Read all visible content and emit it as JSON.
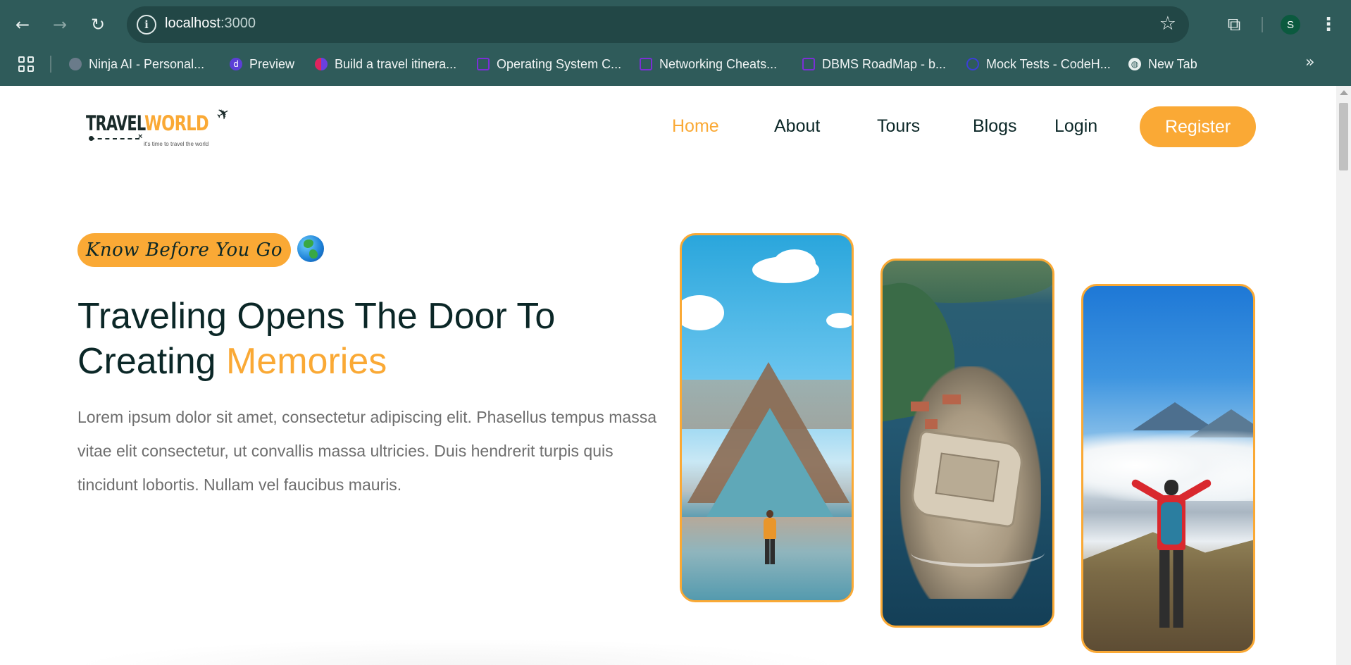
{
  "browser": {
    "url_host": "localhost",
    "url_port": ":3000",
    "profile_initial": "S",
    "bookmarks": [
      {
        "label": "Ninja AI - Personal...",
        "color": "#6a7b8a"
      },
      {
        "label": "Preview",
        "color": "#5b3fd6"
      },
      {
        "label": "Build a travel itinera...",
        "color": "#e0245e"
      },
      {
        "label": "Operating System C...",
        "color": "#7b2fd6"
      },
      {
        "label": "Networking Cheats...",
        "color": "#7b2fd6"
      },
      {
        "label": "DBMS RoadMap - b...",
        "color": "#7b2fd6"
      },
      {
        "label": "Mock Tests - CodeH...",
        "color": "#3b3fd6"
      },
      {
        "label": "New Tab",
        "color": "#e8f0ef"
      }
    ]
  },
  "site": {
    "logo": {
      "word1": "TRAVEL",
      "word2": "WORLD",
      "tagline": "it's time to travel the world"
    },
    "nav": {
      "home": "Home",
      "about": "About",
      "tours": "Tours",
      "blogs": "Blogs",
      "login": "Login",
      "register": "Register"
    },
    "hero": {
      "subtitle": "Know Before You Go",
      "title_part1": "Traveling Opens The Door To Creating ",
      "title_highlight": "Memories",
      "description": "Lorem ipsum dolor sit amet, consectetur adipiscing elit. Phasellus tempus massa vitae elit consectetur, ut convallis massa ultricies. Duis hendrerit turpis quis tincidunt lobortis. Nullam vel faucibus mauris."
    },
    "colors": {
      "accent": "#faa935",
      "heading": "#0b2727",
      "chrome": "#2f5b5a"
    }
  }
}
